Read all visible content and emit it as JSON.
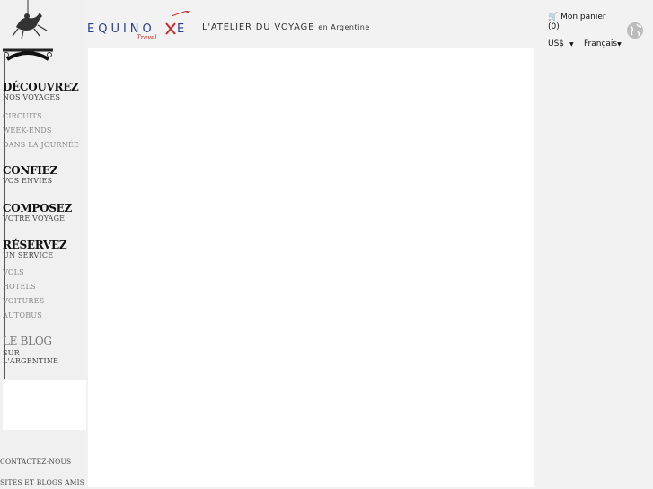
{
  "brand": {
    "name": "EQUINOXE",
    "sub": "Travel"
  },
  "tagline": {
    "main": "L'ATELIER DU VOYAGE",
    "suffix": "en Argentine"
  },
  "cart": {
    "label": "Mon panier",
    "count": "(0)"
  },
  "currency": {
    "value": "US$"
  },
  "language": {
    "value": "Français"
  },
  "menu": {
    "decouvrez": {
      "title": "DÉCOUVREZ",
      "sub": "NOS VOYAGES",
      "items": [
        "CIRCUITS",
        "WEEK-ENDS",
        "DANS LA JOURNÉE"
      ]
    },
    "confiez": {
      "title": "CONFIEZ",
      "sub": "VOS ENVIES"
    },
    "composez": {
      "title": "COMPOSEZ",
      "sub": "VOTRE VOYAGE"
    },
    "reservez": {
      "title": "RÉSERVEZ",
      "sub": "UN SERVICE",
      "items": [
        "VOLS",
        "HOTELS",
        "VOITURES",
        "AUTOBUS"
      ]
    },
    "blog": {
      "title": "LE BLOG",
      "sub1": "SUR",
      "sub2": "L'ARGENTINE"
    }
  },
  "footer": {
    "contact": "CONTACTEZ-NOUS",
    "friends": "SITES ET BLOGS AMIS"
  },
  "colors": {
    "accent": "#cc2a2a",
    "brand_blue": "#2a3f8f"
  }
}
